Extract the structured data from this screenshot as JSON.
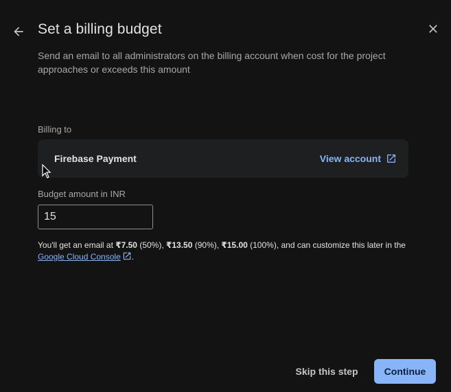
{
  "dialog": {
    "title": "Set a billing budget",
    "subtitle": "Send an email to all administrators on the billing account when cost for the project approaches or exceeds this amount",
    "back_icon": "arrow-back-icon",
    "close_icon": "close-icon"
  },
  "billing": {
    "label": "Billing to",
    "account_name": "Firebase Payment",
    "view_account_label": "View account",
    "view_account_icon": "open-in-new-icon"
  },
  "budget": {
    "label": "Budget amount in INR",
    "value": "15"
  },
  "info": {
    "prefix": "You'll get an email at ",
    "amount1": "₹7.50",
    "pct1": " (50%), ",
    "amount2": "₹13.50",
    "pct2": " (90%), ",
    "amount3": "₹15.00",
    "pct3": " (100%), and can customize this later in the ",
    "link_label": "Google Cloud Console",
    "suffix": "."
  },
  "actions": {
    "skip_label": "Skip this step",
    "continue_label": "Continue"
  },
  "colors": {
    "background": "#131314",
    "card": "#1e1f20",
    "accent": "#8ab4f8"
  }
}
